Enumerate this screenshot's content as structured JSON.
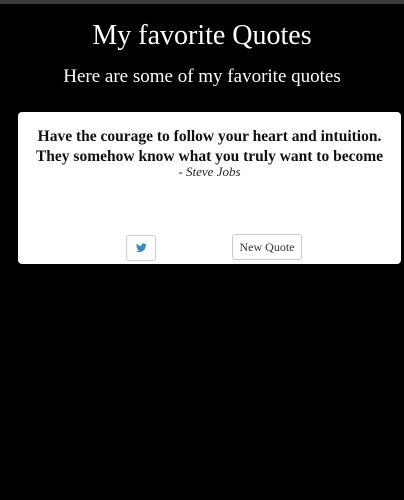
{
  "header": {
    "title": "My favorite Quotes",
    "subtitle": "Here are some of my favorite quotes"
  },
  "quote": {
    "line1": "Have the courage to follow your heart and intuition.",
    "line2": "They somehow know what you truly want to become",
    "author": "- Steve Jobs"
  },
  "actions": {
    "tweet_icon": "twitter-bird-icon",
    "new_quote_label": "New Quote"
  },
  "colors": {
    "background": "#000000",
    "card": "#ffffff",
    "twitter": "#3b88c3"
  }
}
